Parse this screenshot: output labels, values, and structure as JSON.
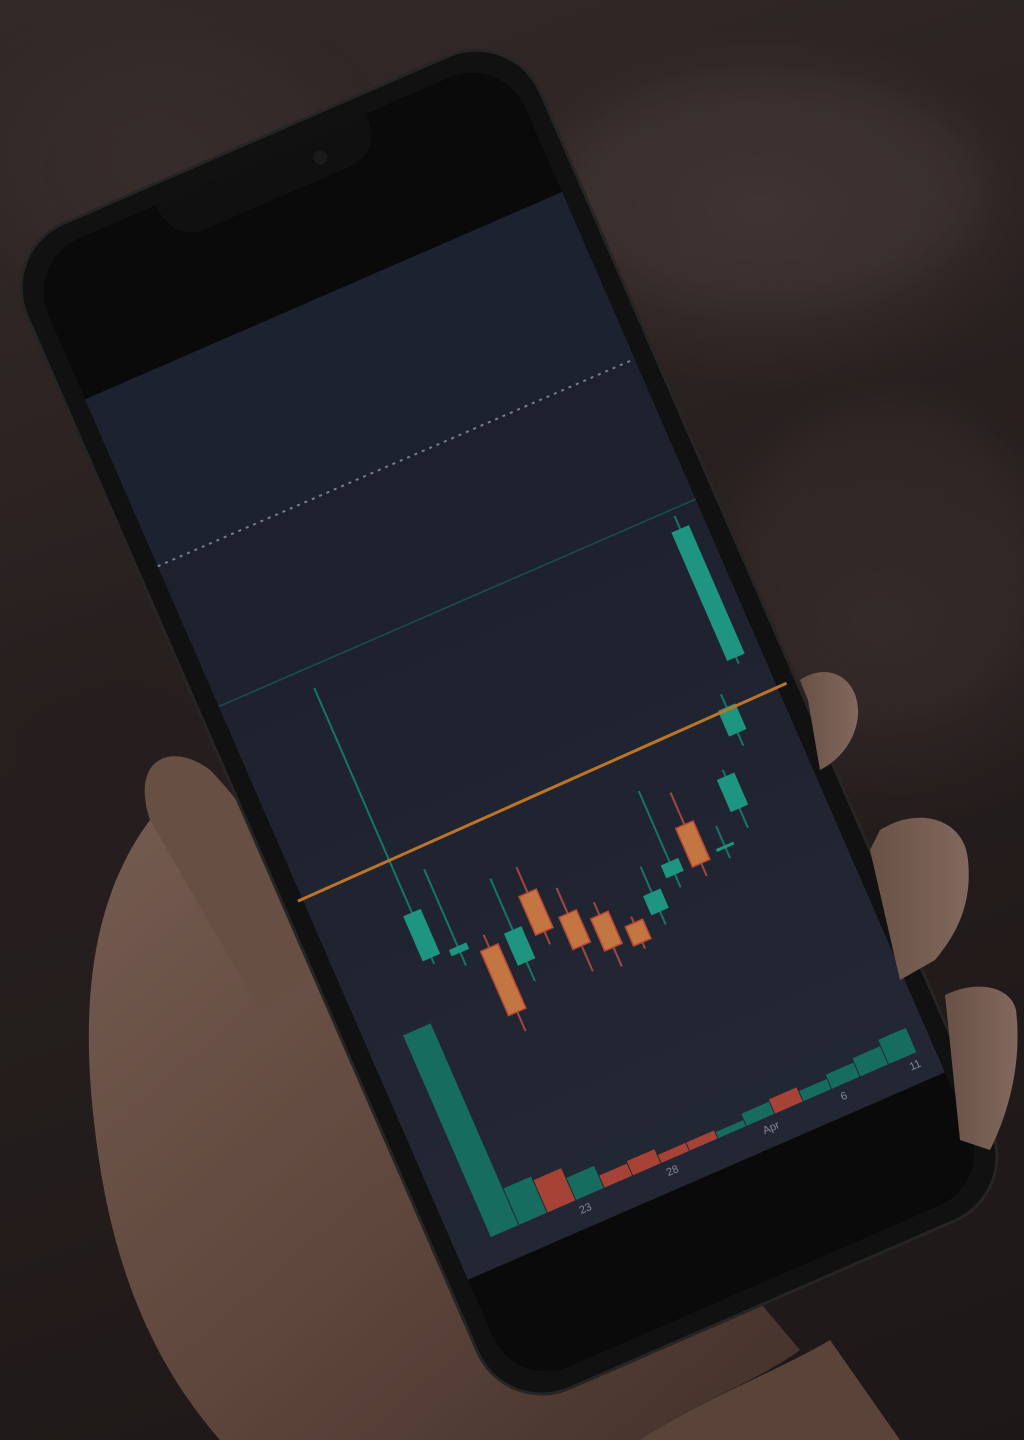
{
  "scene": {
    "description_free": true,
    "device": "smartphone",
    "app_content": "candlestick-chart"
  },
  "colors": {
    "up": "#1fb39a",
    "down": "#e98b4d",
    "down_volume": "#d9533f",
    "trendline": "#e08a2e",
    "screen_bg": "#232a3a",
    "phone_body": "#141414"
  },
  "chart_data": {
    "type": "candlestick",
    "x_tick_labels": [
      "23",
      "28",
      "Apr",
      "6",
      "11"
    ],
    "candles": [
      {
        "index": 0,
        "direction": "up",
        "open": 0.3,
        "close": 0.37,
        "high": 0.72,
        "low": 0.29
      },
      {
        "index": 1,
        "direction": "up",
        "open": 0.29,
        "close": 0.3,
        "high": 0.42,
        "low": 0.27
      },
      {
        "index": 2,
        "direction": "down",
        "open": 0.28,
        "close": 0.18,
        "high": 0.3,
        "low": 0.15
      },
      {
        "index": 3,
        "direction": "up",
        "open": 0.24,
        "close": 0.29,
        "high": 0.37,
        "low": 0.21
      },
      {
        "index": 4,
        "direction": "down",
        "open": 0.33,
        "close": 0.27,
        "high": 0.37,
        "low": 0.25
      },
      {
        "index": 5,
        "direction": "down",
        "open": 0.28,
        "close": 0.23,
        "high": 0.32,
        "low": 0.19
      },
      {
        "index": 6,
        "direction": "down",
        "open": 0.26,
        "close": 0.21,
        "high": 0.28,
        "low": 0.18
      },
      {
        "index": 7,
        "direction": "down",
        "open": 0.23,
        "close": 0.2,
        "high": 0.24,
        "low": 0.19
      },
      {
        "index": 8,
        "direction": "up",
        "open": 0.23,
        "close": 0.26,
        "high": 0.3,
        "low": 0.21
      },
      {
        "index": 9,
        "direction": "up",
        "open": 0.27,
        "close": 0.29,
        "high": 0.4,
        "low": 0.25
      },
      {
        "index": 10,
        "direction": "down",
        "open": 0.33,
        "close": 0.27,
        "high": 0.38,
        "low": 0.25
      },
      {
        "index": 11,
        "direction": "up",
        "open": 0.28,
        "close": 0.28,
        "high": 0.31,
        "low": 0.26
      },
      {
        "index": 12,
        "direction": "up",
        "open": 0.32,
        "close": 0.37,
        "high": 0.38,
        "low": 0.29
      },
      {
        "index": 13,
        "direction": "up",
        "open": 0.42,
        "close": 0.46,
        "high": 0.48,
        "low": 0.4
      },
      {
        "index": 14,
        "direction": "up",
        "open": 0.52,
        "close": 0.72,
        "high": 0.74,
        "low": 0.51
      }
    ],
    "volume": [
      {
        "direction": "up",
        "value": 1.0
      },
      {
        "direction": "up",
        "value": 0.18
      },
      {
        "direction": "down",
        "value": 0.16
      },
      {
        "direction": "up",
        "value": 0.11
      },
      {
        "direction": "down",
        "value": 0.06
      },
      {
        "direction": "down",
        "value": 0.07
      },
      {
        "direction": "down",
        "value": 0.04
      },
      {
        "direction": "down",
        "value": 0.04
      },
      {
        "direction": "up",
        "value": 0.03
      },
      {
        "direction": "up",
        "value": 0.06
      },
      {
        "direction": "down",
        "value": 0.07
      },
      {
        "direction": "up",
        "value": 0.05
      },
      {
        "direction": "up",
        "value": 0.07
      },
      {
        "direction": "up",
        "value": 0.09
      },
      {
        "direction": "up",
        "value": 0.12
      }
    ],
    "trendline": {
      "present": true
    },
    "grid": false
  }
}
